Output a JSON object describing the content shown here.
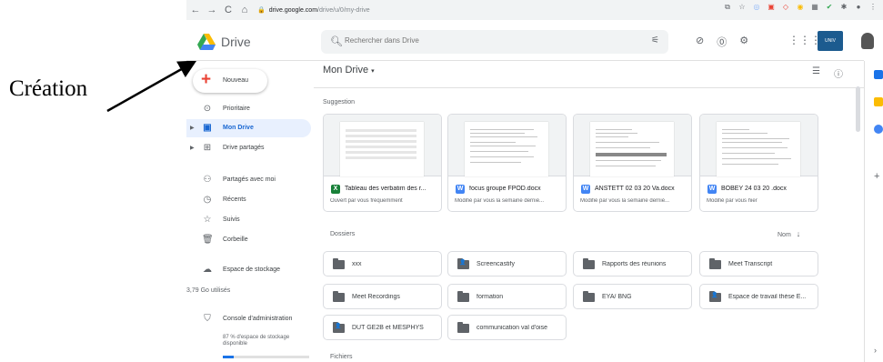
{
  "annotation": {
    "label": "Création"
  },
  "browser": {
    "back": "←",
    "forward": "→",
    "reload": "C",
    "home": "⌂",
    "url_host": "drive.google.com",
    "url_path": "/drive/u/0/my-drive"
  },
  "header": {
    "app_name": "Drive",
    "search_placeholder": "Rechercher dans Drive",
    "org_logo_text": "UNIV"
  },
  "sidebar": {
    "new_label": "Nouveau",
    "items": [
      {
        "label": "Prioritaire",
        "icon": "check-circle-icon"
      },
      {
        "label": "Mon Drive",
        "icon": "my-drive-icon",
        "active": true
      },
      {
        "label": "Drive partagés",
        "icon": "shared-drives-icon"
      },
      {
        "label": "Partagés avec moi",
        "icon": "people-icon"
      },
      {
        "label": "Récents",
        "icon": "clock-icon"
      },
      {
        "label": "Suivis",
        "icon": "star-icon"
      },
      {
        "label": "Corbeille",
        "icon": "trash-icon"
      },
      {
        "label": "Espace de stockage",
        "icon": "cloud-icon"
      },
      {
        "label": "Console d'administration",
        "icon": "admin-icon"
      }
    ],
    "storage_used": "3,79 Go utilisés",
    "admin_storage_note": "87 % d'espace de stockage disponible",
    "storage_fraction": 0.13
  },
  "main": {
    "title": "Mon Drive",
    "suggestion_label": "Suggestion",
    "suggestions": [
      {
        "type": "X",
        "color": "#188038",
        "name": "Tableau des verbatim des r...",
        "reason": "Ouvert par vous fréquemment"
      },
      {
        "type": "W",
        "color": "#4285f4",
        "name": "focus groupe FPOD.docx",
        "reason": "Modifié par vous la semaine derniè..."
      },
      {
        "type": "W",
        "color": "#4285f4",
        "name": "ANSTETT 02 03 20 Va.docx",
        "reason": "Modifié par vous la semaine derniè..."
      },
      {
        "type": "W",
        "color": "#4285f4",
        "name": "BOBEY 24 03 20 .docx",
        "reason": "Modifié par vous hier"
      }
    ],
    "folders_label": "Dossiers",
    "sort_label": "Nom",
    "folders": [
      {
        "name": "xxx",
        "shared": false
      },
      {
        "name": "Screencastify",
        "shared": true
      },
      {
        "name": "Rapports des réunions",
        "shared": false
      },
      {
        "name": "Meet Transcript",
        "shared": false
      },
      {
        "name": "Meet Recordings",
        "shared": false
      },
      {
        "name": "formation",
        "shared": false
      },
      {
        "name": "EYA/ BNG",
        "shared": false
      },
      {
        "name": "Espace de travail thèse E...",
        "shared": true
      },
      {
        "name": "DUT GE2B et MESPHYS",
        "shared": true
      },
      {
        "name": "communication val d'oise",
        "shared": false
      }
    ],
    "files_label": "Fichiers"
  }
}
